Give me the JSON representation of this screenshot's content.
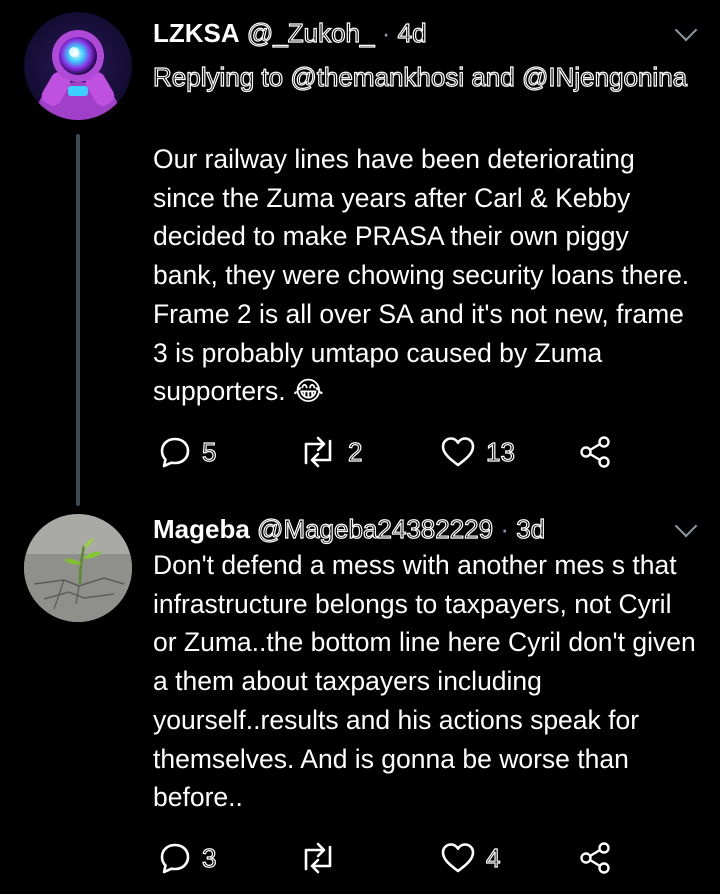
{
  "tweets": [
    {
      "display_name": "LZKSA",
      "handle": "@_Zukoh_",
      "separator": "·",
      "time": "4d",
      "replying_prefix": "Replying to",
      "replying_to": "@themankhosi and @INjengonina",
      "text": "Our railway lines have been deteriorating since the Zuma years after Carl & Kebby decided to make PRASA their own piggy bank, they were chowing security loans there. Frame 2 is all over SA and it's not new, frame 3 is probably umtapo caused by Zuma supporters. 😂",
      "replies": "5",
      "retweets": "2",
      "likes": "13"
    },
    {
      "display_name": "Mageba",
      "handle": "@Mageba24382229",
      "separator": "·",
      "time": "3d",
      "text": "Don't defend a mess with another mes s that infrastructure belongs to taxpayers, not Cyril or Zuma..the bottom line here Cyril don't given a them about taxpayers including yourself..results and his actions speak for themselves. And is gonna be worse  than before..",
      "replies": "3",
      "retweets": "",
      "likes": "4"
    }
  ],
  "colors": {
    "background": "#000000",
    "text": "#ffffff",
    "muted": "#8b98a5",
    "thread_line": "#3d4a56"
  }
}
